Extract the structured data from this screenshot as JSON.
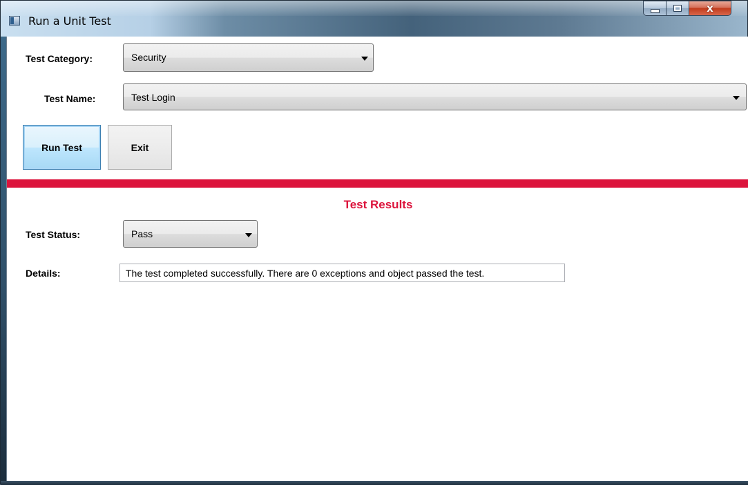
{
  "window": {
    "title": "Run a Unit Test",
    "close_glyph": "x",
    "icons": {
      "app": "app-window-icon",
      "minimize": "minimize-icon",
      "maximize": "maximize-icon",
      "close": "close-icon"
    }
  },
  "form": {
    "test_category": {
      "label": "Test Category:",
      "value": "Security"
    },
    "test_name": {
      "label": "Test Name:",
      "value": "Test Login"
    },
    "run_button": "Run Test",
    "exit_button": "Exit"
  },
  "results": {
    "title": "Test Results",
    "test_status": {
      "label": "Test Status:",
      "value": "Pass"
    },
    "details": {
      "label": "Details:",
      "value": "The test completed successfully. There are 0 exceptions and object passed the test."
    }
  },
  "colors": {
    "accent_red": "#dc143c",
    "default_button_border": "#3c7fb1"
  }
}
